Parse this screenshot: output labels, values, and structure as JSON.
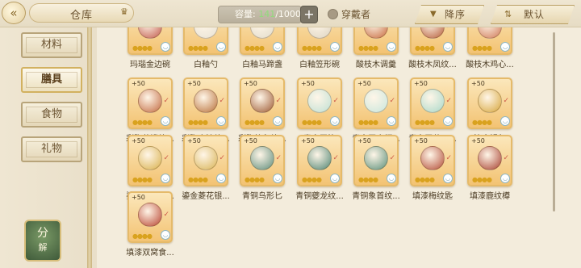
{
  "header": {
    "back_icon": "back-arrow-icon",
    "title": "仓库",
    "capacity_label": "容量:",
    "capacity_current": "141",
    "capacity_max": "/1000",
    "add_label": "+",
    "wearer_label": "穿戴者",
    "sort_label": "降序",
    "default_label": "默认"
  },
  "sidebar": {
    "items": [
      {
        "label": "材料"
      },
      {
        "label": "膳具"
      },
      {
        "label": "食物"
      },
      {
        "label": "礼物"
      }
    ],
    "active_index": 1,
    "decompose_line1": "分",
    "decompose_line2": "解"
  },
  "items": [
    {
      "name": "玛瑙金边碗",
      "bonus": "",
      "color": "#c25b4d"
    },
    {
      "name": "白釉勺",
      "bonus": "",
      "color": "#e8e2d4"
    },
    {
      "name": "白釉马蹄盏",
      "bonus": "",
      "color": "#e2dccb"
    },
    {
      "name": "白釉笠形碗",
      "bonus": "",
      "color": "#ded5c2"
    },
    {
      "name": "酸枝木调羹",
      "bonus": "",
      "color": "#c76a3e"
    },
    {
      "name": "酸枝木凤纹...",
      "bonus": "",
      "color": "#b65d3a"
    },
    {
      "name": "酸枝木鸡心...",
      "bonus": "",
      "color": "#d07a58"
    },
    {
      "name": "彩陶花瓣纹...",
      "bonus": "+50",
      "color": "#c2693f"
    },
    {
      "name": "彩陶水波纹...",
      "bonus": "+50",
      "color": "#b9713a"
    },
    {
      "name": "彩陶鲵鱼纹...",
      "bonus": "+50",
      "color": "#9e5a33"
    },
    {
      "name": "青白玉筷",
      "bonus": "+50",
      "color": "#bfe0d4"
    },
    {
      "name": "青白玉高柄...",
      "bonus": "+50",
      "color": "#c8e6dc"
    },
    {
      "name": "青白玉菱口...",
      "bonus": "+50",
      "color": "#a9d8c9"
    },
    {
      "name": "鎏金银勺",
      "bonus": "+50",
      "color": "#d7a63b"
    },
    {
      "name": "鎏金八棱银...",
      "bonus": "+50",
      "color": "#d9b04b"
    },
    {
      "name": "鎏金菱花银...",
      "bonus": "+50",
      "color": "#d9b456"
    },
    {
      "name": "青铜鸟形匕",
      "bonus": "+50",
      "color": "#5e8c7a"
    },
    {
      "name": "青铜夔龙纹...",
      "bonus": "+50",
      "color": "#4f8472"
    },
    {
      "name": "青铜象首纹...",
      "bonus": "+50",
      "color": "#5b8f79"
    },
    {
      "name": "填漆梅纹匙",
      "bonus": "+50",
      "color": "#b34c36"
    },
    {
      "name": "填漆鹿纹樽",
      "bonus": "+50",
      "color": "#a8402f"
    },
    {
      "name": "填漆双窝食...",
      "bonus": "+50",
      "color": "#b8432f"
    }
  ]
}
